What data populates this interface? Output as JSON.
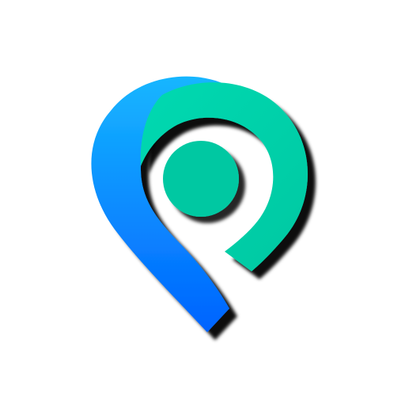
{
  "logo": {
    "icon": "location-pin-logo",
    "colors": {
      "blue_start": "#16b6ff",
      "blue_end": "#0063ff",
      "green": "#00c8a2",
      "green_light": "#00d9b1",
      "shadow": "#000000",
      "background": "#ffffff"
    }
  }
}
